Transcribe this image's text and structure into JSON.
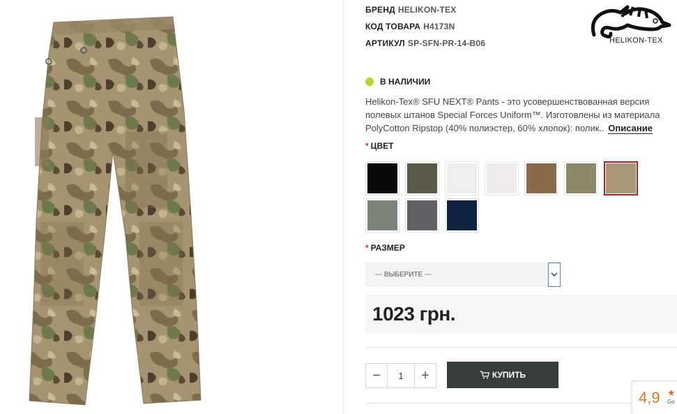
{
  "meta": [
    {
      "label": "БРЕНД",
      "value": "HELIKON-TEX"
    },
    {
      "label": "КОД ТОВАРА",
      "value": "H4173N"
    },
    {
      "label": "АРТИКУЛ",
      "value": "SP-SFN-PR-14-B06"
    }
  ],
  "logo": {
    "text": "HELIKON-TEX",
    "icon": "chameleon-logo-icon"
  },
  "stock": {
    "text": "В НАЛИЧИИ",
    "color": "#bcd22a"
  },
  "description": {
    "text": "Helikon-Tex® SFU NEXT® Pants - это усовершенствованная версия полевых штанов Special Forces Uniform™. Изготовлены из материала PolyCotton Ripstop (40% полиэстер, 60% хлопок): полик..",
    "more": "Описание"
  },
  "color_field": {
    "required": "*",
    "label": "ЦВЕТ"
  },
  "swatches": [
    {
      "color": "#0a0a0a",
      "selected": false
    },
    {
      "color": "#5b5a48",
      "selected": false
    },
    {
      "color": "#eeeeee",
      "selected": false
    },
    {
      "color": "#f0ecec",
      "selected": false
    },
    {
      "color": "#8b6a48",
      "selected": false
    },
    {
      "color": "#8d8a6c",
      "selected": false
    },
    {
      "color": "#a89878",
      "selected": true
    },
    {
      "color": "#7d8478",
      "selected": false
    },
    {
      "color": "#5f6164",
      "selected": false
    },
    {
      "color": "#0d2341",
      "selected": false
    }
  ],
  "size_field": {
    "required": "*",
    "label": "РАЗМЕР",
    "placeholder": "--- ВЫБЕРИТЕ ---"
  },
  "price": "1023 грн.",
  "quantity": {
    "minus": "−",
    "value": "1",
    "plus": "+"
  },
  "buy_button": {
    "label": "КУПИТЬ"
  },
  "rating": {
    "value": "4,9",
    "star": "★",
    "sub": "Go"
  }
}
